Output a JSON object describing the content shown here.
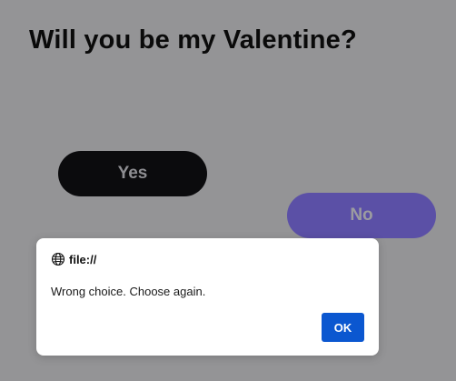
{
  "page": {
    "title": "Will you be my Valentine?"
  },
  "buttons": {
    "yes_label": "Yes",
    "no_label": "No"
  },
  "dialog": {
    "origin": "file://",
    "origin_icon": "globe-icon",
    "message": "Wrong choice. Choose again.",
    "ok_label": "OK"
  },
  "colors": {
    "background": "#949496",
    "yes_button": "#0b0b0d",
    "no_button": "#5b50a6",
    "ok_button": "#0b57d0"
  }
}
